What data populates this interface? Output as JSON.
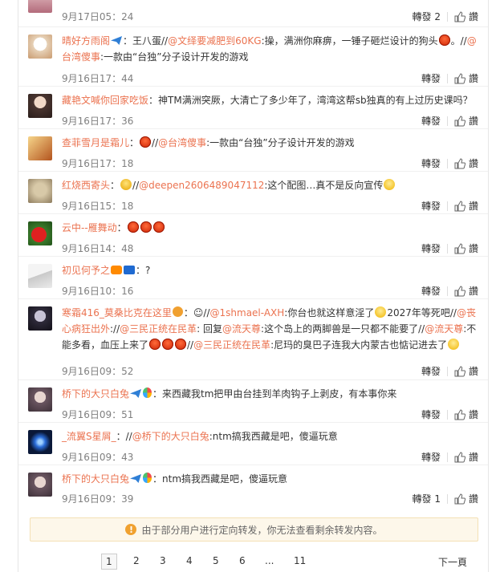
{
  "actions": {
    "forward": "轉發",
    "like": "讚"
  },
  "items": [
    {
      "user": "",
      "sep": "",
      "text_plain": "",
      "time": "9月17日05：24",
      "forward_count": "2"
    },
    {
      "user": "晴好方雨阁",
      "t1": "：王八蛋//",
      "m1": "@文绎要减肥到60KG",
      "t2": ":操，满洲你麻痹，一锤子砸烂设计的狗头",
      "t3": "。//",
      "m2": "@台湾傻事",
      "t4": ":一款由“台独”分子设计开发的游戏",
      "time": "9月16日17：44"
    },
    {
      "user": "藏艳文喊你回家吃饭",
      "t1": "：神TM满洲突厥，大清亡了多少年了，湾湾这帮sb独真的有上过历史课吗？",
      "time": "9月16日17：36"
    },
    {
      "user": "查菲雪月是霜儿",
      "t1": "：",
      "t2": "//",
      "m1": "@台湾傻事",
      "t3": ":一款由“台独”分子设计开发的游戏",
      "time": "9月16日17：18"
    },
    {
      "user": "红烧西寄头",
      "t1": "：",
      "t2": "//",
      "m1": "@deepen2606489047112",
      "t3": ":这个配图…真不是反向宣传",
      "time": "9月16日15：18"
    },
    {
      "user": "云中--雁舞动",
      "t1": "：",
      "time": "9月16日14：48"
    },
    {
      "user": "初见何予之",
      "t1": "：?",
      "time": "9月16日10：16"
    },
    {
      "user": "寒霜416_莫桑比克在这里",
      "t1": "：☺//",
      "m1": "@1shmael-AXH",
      "t2": ":你台也就这样意淫了",
      "t3": "2027年等死吧//",
      "m2": "@丧心病狂出外",
      "t4": "://",
      "m3": "@三民正统在民革",
      "t5": ": 回复",
      "m4": "@流天尊",
      "t6": ":这个岛上的两脚兽是一只都不能要了//",
      "m5": "@流天尊",
      "t7": ":不能多看，血压上来了",
      "t8": "//",
      "m6": "@三民正统在民革",
      "t9": ":尼玛的臭巴子连我大内蒙古也惦记进去了",
      "time": "9月16日09：52"
    },
    {
      "user": "桥下的大只白兔",
      "t1": "：来西藏我tm把甲由台挂到羊肉钩子上剥皮，有本事你来",
      "time": "9月16日09：51"
    },
    {
      "user": "_流翼S星屑_",
      "t1": "：//",
      "m1": "@桥下的大只白兔",
      "t2": ":ntm搞我西藏是吧，傻逼玩意",
      "time": "9月16日09：43"
    },
    {
      "user": "桥下的大只白兔",
      "t1": "：ntm搞我西藏是吧，傻逼玩意",
      "time": "9月16日09：39",
      "forward_count": "1"
    }
  ],
  "notice": "由于部分用户进行定向转发，你无法查看剩余转发内容。",
  "pagination": {
    "pages": [
      "1",
      "2",
      "3",
      "4",
      "5",
      "6",
      "...",
      "11"
    ],
    "current": "1",
    "next": "下一頁"
  },
  "colors": {
    "link": "#eb7350",
    "time": "#808080",
    "notice_bg": "#fdf7ea"
  }
}
